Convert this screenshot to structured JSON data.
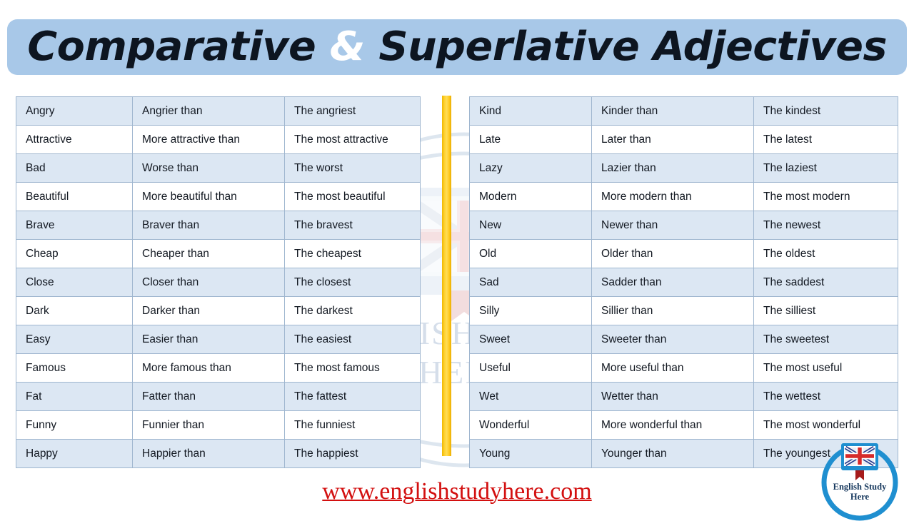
{
  "title": {
    "part1": "Comparative ",
    "amp": "&",
    "part2": " Superlative Adjectives"
  },
  "watermark": {
    "line1": "ENGLISH STUDY",
    "line2": "HERE",
    "icon": "book-flag-icon"
  },
  "divider": {
    "color": "#ffd233",
    "name": "vertical-divider"
  },
  "tables": {
    "left": {
      "rows": [
        {
          "adjective": "Angry",
          "comparative": "Angrier than",
          "superlative": "The angriest"
        },
        {
          "adjective": "Attractive",
          "comparative": "More attractive than",
          "superlative": "The most attractive"
        },
        {
          "adjective": "Bad",
          "comparative": "Worse than",
          "superlative": "The worst"
        },
        {
          "adjective": "Beautiful",
          "comparative": "More beautiful than",
          "superlative": "The  most beautiful"
        },
        {
          "adjective": "Brave",
          "comparative": "Braver than",
          "superlative": "The bravest"
        },
        {
          "adjective": "Cheap",
          "comparative": "Cheaper than",
          "superlative": "The cheapest"
        },
        {
          "adjective": "Close",
          "comparative": "Closer than",
          "superlative": "The closest"
        },
        {
          "adjective": "Dark",
          "comparative": "Darker than",
          "superlative": "The darkest"
        },
        {
          "adjective": "Easy",
          "comparative": "Easier than",
          "superlative": "The easiest"
        },
        {
          "adjective": "Famous",
          "comparative": "More famous than",
          "superlative": "The most famous"
        },
        {
          "adjective": "Fat",
          "comparative": "Fatter than",
          "superlative": "The fattest"
        },
        {
          "adjective": "Funny",
          "comparative": "Funnier than",
          "superlative": "The funniest"
        },
        {
          "adjective": "Happy",
          "comparative": "Happier than",
          "superlative": "The happiest"
        }
      ]
    },
    "right": {
      "rows": [
        {
          "adjective": "Kind",
          "comparative": "Kinder than",
          "superlative": "The kindest"
        },
        {
          "adjective": "Late",
          "comparative": "Later than",
          "superlative": "The latest"
        },
        {
          "adjective": "Lazy",
          "comparative": "Lazier than",
          "superlative": "The laziest"
        },
        {
          "adjective": "Modern",
          "comparative": "More modern than",
          "superlative": "The most modern"
        },
        {
          "adjective": "New",
          "comparative": "Newer than",
          "superlative": "The newest"
        },
        {
          "adjective": "Old",
          "comparative": "Older than",
          "superlative": "The oldest"
        },
        {
          "adjective": "Sad",
          "comparative": "Sadder than",
          "superlative": "The saddest"
        },
        {
          "adjective": "Silly",
          "comparative": "Sillier than",
          "superlative": "The silliest"
        },
        {
          "adjective": "Sweet",
          "comparative": "Sweeter than",
          "superlative": "The sweetest"
        },
        {
          "adjective": "Useful",
          "comparative": "More useful than",
          "superlative": "The most useful"
        },
        {
          "adjective": "Wet",
          "comparative": "Wetter than",
          "superlative": "The wettest"
        },
        {
          "adjective": "Wonderful",
          "comparative": "More wonderful than",
          "superlative": "The most wonderful"
        },
        {
          "adjective": "Young",
          "comparative": "Younger than",
          "superlative": "The youngest"
        }
      ]
    }
  },
  "footer": {
    "url": "www.englishstudyhere.com"
  },
  "logo": {
    "caption_line1": "English Study",
    "caption_line2": "Here",
    "icon": "book-union-jack-icon",
    "ring_color": "#1f8fd0"
  },
  "colors": {
    "banner": "#a8c8e8",
    "row_odd": "#dce7f3",
    "row_even": "#ffffff",
    "cell_border": "#9fb6cf",
    "divider": "#ffd233",
    "url": "#d31010"
  }
}
